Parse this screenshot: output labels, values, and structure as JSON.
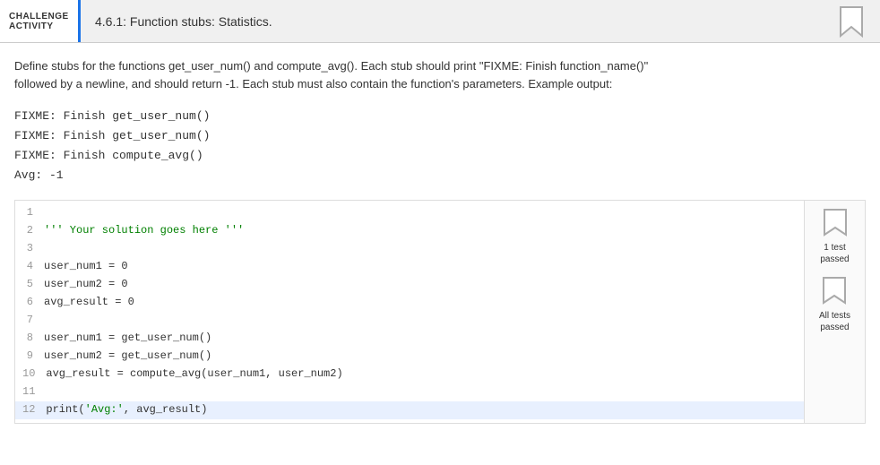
{
  "header": {
    "challenge_top": "CHALLENGE",
    "challenge_bottom": "ACTIVITY",
    "title": "4.6.1: Function stubs: Statistics."
  },
  "description": {
    "text1": "Define stubs for the functions get_user_num() and compute_avg(). Each stub should print \"FIXME: Finish function_name()\"",
    "text2": "followed by a newline, and should return -1. Each stub must also contain the function's parameters. Example output:"
  },
  "example_output": {
    "lines": [
      "FIXME: Finish get_user_num()",
      "FIXME: Finish get_user_num()",
      "FIXME: Finish compute_avg()",
      "Avg: -1"
    ]
  },
  "code": {
    "lines": [
      {
        "num": "1",
        "content": ""
      },
      {
        "num": "2",
        "content": "''' Your solution goes here '''",
        "type": "string"
      },
      {
        "num": "3",
        "content": ""
      },
      {
        "num": "4",
        "content": "user_num1 = 0"
      },
      {
        "num": "5",
        "content": "user_num2 = 0"
      },
      {
        "num": "6",
        "content": "avg_result = 0"
      },
      {
        "num": "7",
        "content": ""
      },
      {
        "num": "8",
        "content": "user_num1 = get_user_num()"
      },
      {
        "num": "9",
        "content": "user_num2 = get_user_num()"
      },
      {
        "num": "10",
        "content": "avg_result = compute_avg(user_num1, user_num2)"
      },
      {
        "num": "11",
        "content": ""
      },
      {
        "num": "12",
        "content": "print('Avg:', avg_result)",
        "highlighted": true
      }
    ]
  },
  "test_results": [
    {
      "label": "1 test\npassed",
      "passed": true
    },
    {
      "label": "All tests\npassed",
      "passed": true
    }
  ],
  "icons": {
    "bookmark": "bookmark-icon"
  }
}
